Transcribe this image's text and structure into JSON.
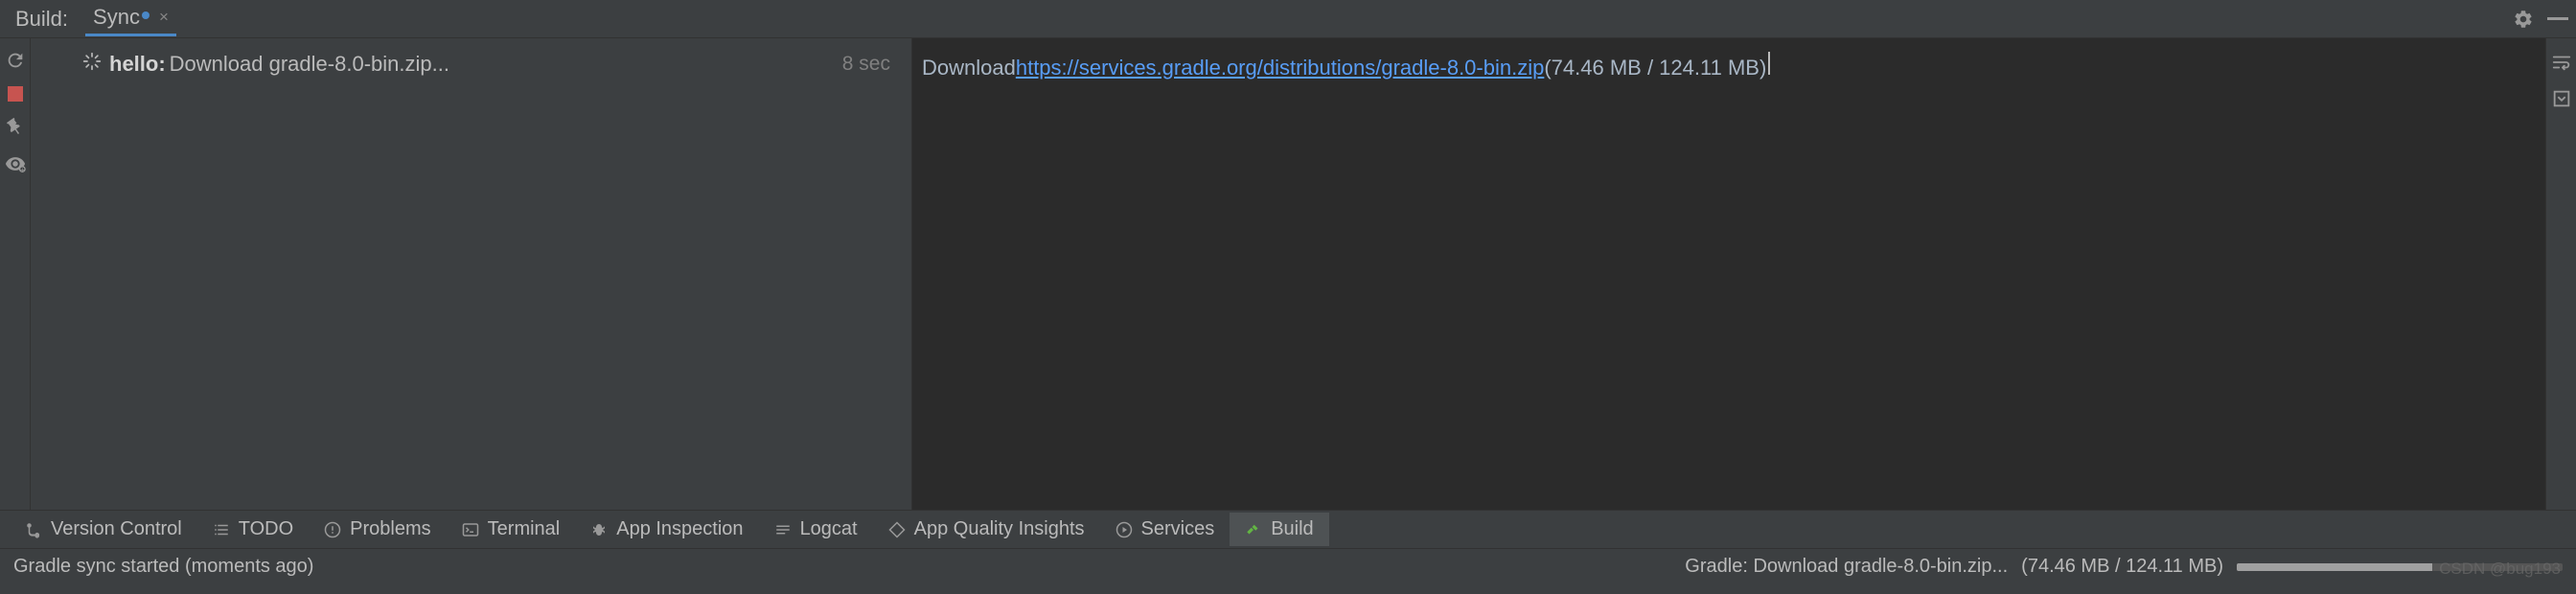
{
  "topbar": {
    "panel_label": "Build:",
    "tab_label": "Sync"
  },
  "tree": {
    "task_name": "hello:",
    "task_desc": "Download gradle-8.0-bin.zip...",
    "elapsed": "8 sec"
  },
  "console": {
    "prefix": "Download ",
    "url": "https://services.gradle.org/distributions/gradle-8.0-bin.zip",
    "progress": " (74.46 MB / 124.11 MB)"
  },
  "toolbar": {
    "version_control": "Version Control",
    "todo": "TODO",
    "problems": "Problems",
    "terminal": "Terminal",
    "app_inspection": "App Inspection",
    "logcat": "Logcat",
    "app_quality": "App Quality Insights",
    "services": "Services",
    "build": "Build"
  },
  "status": {
    "left": "Gradle sync started (moments ago)",
    "right_label": "Gradle: Download gradle-8.0-bin.zip...",
    "right_progress": "(74.46 MB / 124.11 MB)",
    "watermark": "CSDN @bug193"
  },
  "colors": {
    "accent": "#4a88c7",
    "link": "#589df6",
    "stop": "#c75450"
  }
}
